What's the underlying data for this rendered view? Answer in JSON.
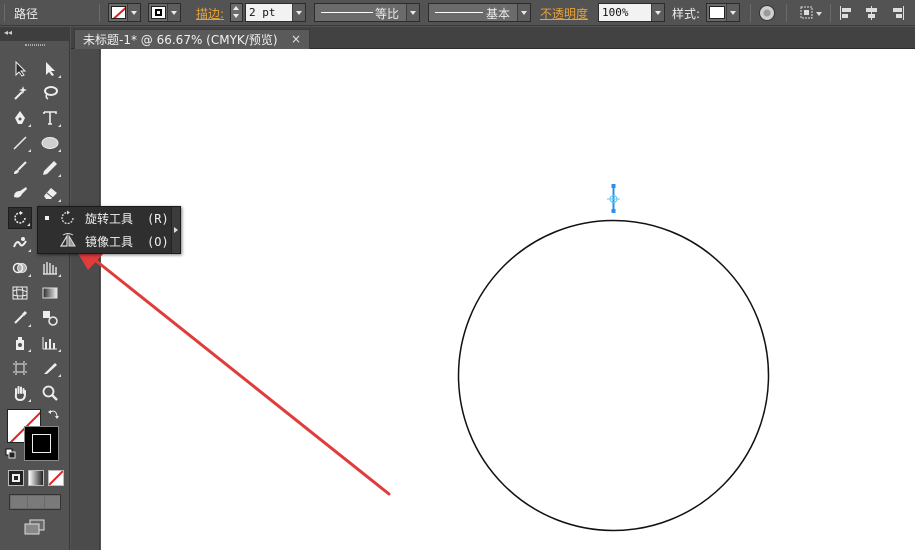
{
  "control_bar": {
    "object_type": "路径",
    "stroke_label": "描边:",
    "stroke_weight": "2 pt",
    "profile_uniform": "等比",
    "brush_basic": "基本",
    "opacity_label": "不透明度",
    "opacity_value": "100%",
    "style_label": "样式:"
  },
  "document_tab": {
    "title": "未标题-1* @ 66.67% (CMYK/预览)",
    "close_glyph": "×"
  },
  "flyout": {
    "items": [
      {
        "label": "旋转工具",
        "shortcut": "(R)",
        "selected": true,
        "icon": "rotate-icon"
      },
      {
        "label": "镜像工具",
        "shortcut": "(O)",
        "selected": false,
        "icon": "reflect-icon"
      }
    ]
  },
  "toolbox": {
    "active_tool": "rotate-tool",
    "collapse_glyph": "◂◂"
  },
  "colors": {
    "panel_bg": "#535353",
    "canvas_bg": "#ffffff",
    "annotation_arrow": "#e03c3c",
    "accent_orange": "#e8a23a",
    "selection_blue": "#2a8ff0"
  },
  "canvas": {
    "shapes": [
      "circle-path"
    ],
    "annotation": "red-arrow-pointing-to-reflect-tool"
  }
}
